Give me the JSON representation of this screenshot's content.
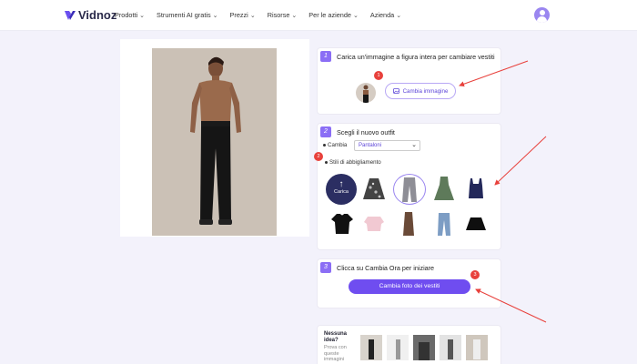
{
  "header": {
    "brand": "Vidnoz",
    "nav": [
      {
        "label": "Prodotti"
      },
      {
        "label": "Strumenti AI gratis"
      },
      {
        "label": "Prezzi"
      },
      {
        "label": "Risorse"
      },
      {
        "label": "Per le aziende"
      },
      {
        "label": "Azienda"
      }
    ]
  },
  "step1": {
    "number": "1",
    "title": "Carica un'immagine a figura intera per cambiare vestiti",
    "badge": "1",
    "button_label": "Cambia immagine"
  },
  "step2": {
    "number": "2",
    "title": "Scegli il nuovo outfit",
    "change_label": "Cambia",
    "change_value": "Pantaloni",
    "styles_label": "Stili di abbigliamento",
    "badge": "2",
    "upload_label": "Carica",
    "garments": [
      {
        "icon": "skirt-floral-icon"
      },
      {
        "icon": "jeans-grey-icon",
        "selected": true
      },
      {
        "icon": "dress-green-icon"
      },
      {
        "icon": "top-navy-icon"
      },
      {
        "icon": "tshirt-black-icon"
      },
      {
        "icon": "top-pink-icon"
      },
      {
        "icon": "dress-brown-icon"
      },
      {
        "icon": "jeans-blue-icon"
      },
      {
        "icon": "skirt-black-icon"
      }
    ]
  },
  "step3": {
    "number": "3",
    "title": "Clicca su Cambia Ora per iniziare",
    "badge": "3",
    "cta_label": "Cambia foto dei vestiti"
  },
  "ideas": {
    "title": "Nessuna idea?",
    "subtitle": "Prova con queste immagini"
  },
  "colors": {
    "accent": "#6f4df0",
    "step_badge": "#8b6ef5",
    "annotation": "#e8413c"
  }
}
